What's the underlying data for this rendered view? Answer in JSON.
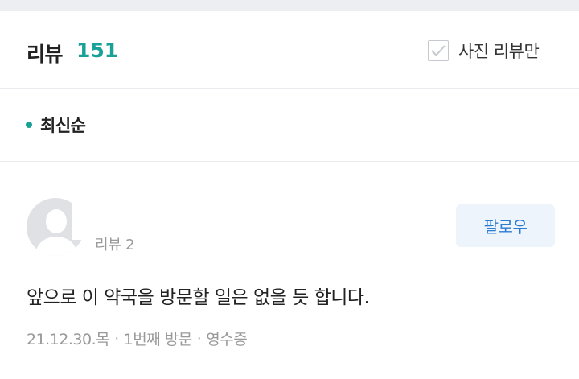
{
  "header": {
    "title": "리뷰",
    "count": "151",
    "photo_filter_label": "사진 리뷰만"
  },
  "sort": {
    "label": "최신순"
  },
  "review": {
    "user_meta": "리뷰 2",
    "follow_label": "팔로우",
    "text": "앞으로 이 약국을 방문할 일은 없을 듯 합니다.",
    "date": "21.12.30.목",
    "visit": "1번째 방문",
    "receipt": "영수증",
    "separator": "·"
  },
  "colors": {
    "accent": "#1aa197",
    "follow_text": "#2b7cd3",
    "follow_bg": "#edf4fb"
  }
}
